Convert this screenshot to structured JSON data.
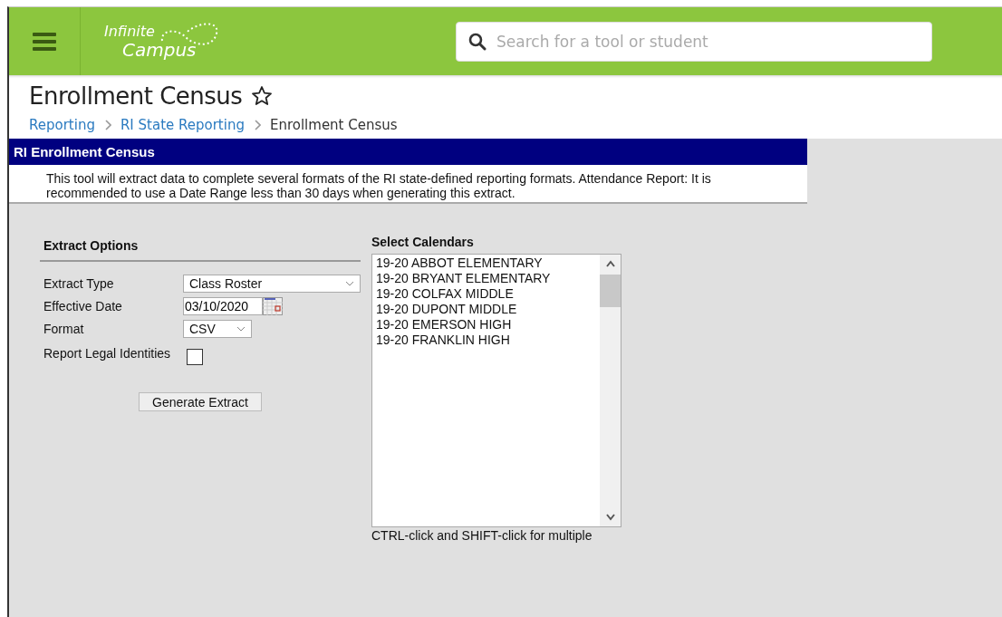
{
  "header": {
    "logo": {
      "line1": "Infinite",
      "line2": "Campus"
    },
    "search": {
      "placeholder": "Search for a tool or student"
    }
  },
  "page": {
    "title": "Enrollment Census",
    "favorite": false,
    "breadcrumbs": [
      {
        "label": "Reporting",
        "link": true
      },
      {
        "label": "RI State Reporting",
        "link": true
      },
      {
        "label": "Enrollment Census",
        "link": false
      }
    ]
  },
  "panel": {
    "title": "RI Enrollment Census",
    "description": "This tool will extract data to complete several formats of the RI state-defined reporting formats. Attendance Report: It is recommended to use a Date Range less than 30 days when generating this extract."
  },
  "extract_options": {
    "title": "Extract Options",
    "fields": [
      {
        "kind": "select",
        "label": "Extract Type",
        "value": "Class Roster"
      },
      {
        "kind": "date",
        "label": "Effective Date",
        "value": "03/10/2020"
      },
      {
        "kind": "select-small",
        "label": "Format",
        "value": "CSV"
      },
      {
        "kind": "checkbox",
        "label": "Report Legal Identities",
        "checked": false
      }
    ],
    "button": "Generate Extract"
  },
  "calendars": {
    "title": "Select Calendars",
    "items": [
      {
        "label": "19-20 ABBOT ELEMENTARY",
        "selected": false
      },
      {
        "label": "19-20 BRYANT ELEMENTARY",
        "selected": false
      },
      {
        "label": "19-20 COLFAX MIDDLE",
        "selected": false
      },
      {
        "label": "19-20 DUPONT MIDDLE",
        "selected": false
      },
      {
        "label": "19-20 EMERSON HIGH",
        "selected": false
      },
      {
        "label": "19-20 FRANKLIN HIGH",
        "selected": false
      }
    ],
    "hint": "CTRL-click and SHIFT-click for multiple"
  }
}
